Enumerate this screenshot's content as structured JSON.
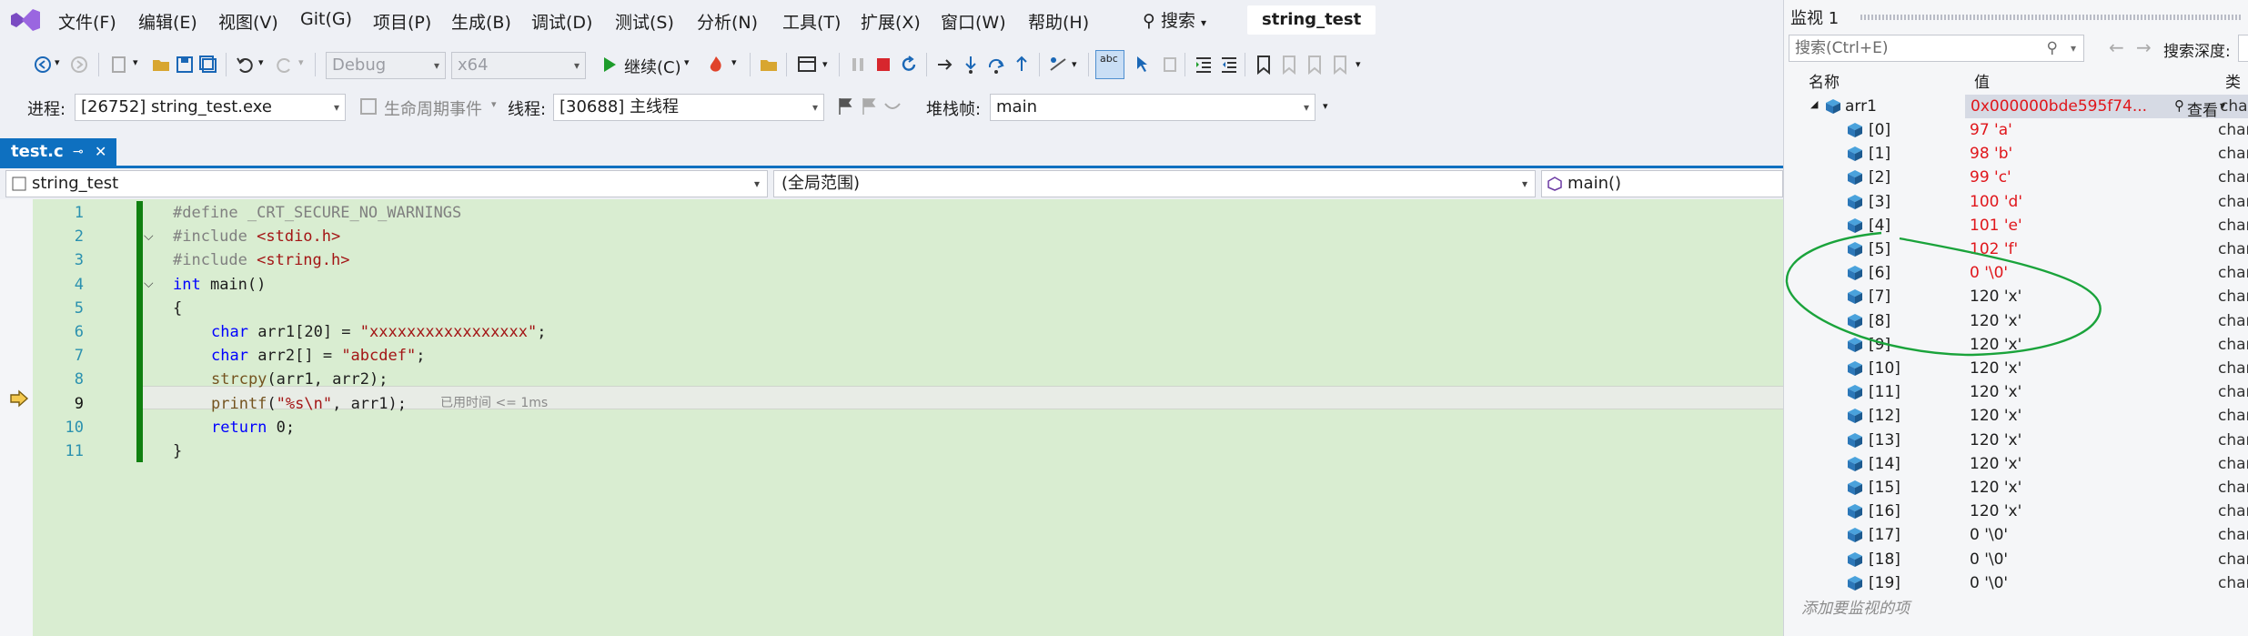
{
  "menu": {
    "items": [
      "文件(F)",
      "编辑(E)",
      "视图(V)",
      "Git(G)",
      "项目(P)",
      "生成(B)",
      "调试(D)",
      "测试(S)",
      "分析(N)",
      "工具(T)",
      "扩展(X)",
      "窗口(W)",
      "帮助(H)"
    ],
    "search_label": "搜索",
    "solution_title": "string_test"
  },
  "toolbar": {
    "config": "Debug",
    "platform": "x64",
    "continue_label": "继续(C)"
  },
  "debugbar": {
    "process_label": "进程:",
    "process_value": "[26752] string_test.exe",
    "lifecycle_label": "生命周期事件",
    "thread_label": "线程:",
    "thread_value": "[30688] 主线程",
    "stackframe_label": "堆栈帧:",
    "stackframe_value": "main"
  },
  "tab": {
    "name": "test.c",
    "pin": "⊸"
  },
  "navbar": {
    "project": "string_test",
    "scope": "(全局范围)",
    "member": "main()"
  },
  "editor": {
    "line_numbers": [
      "1",
      "2",
      "3",
      "4",
      "5",
      "6",
      "7",
      "8",
      "9",
      "10",
      "11"
    ],
    "current_line": 9,
    "perf_tip": "已用时间 <= 1ms",
    "lines": [
      {
        "text": "#define _CRT_SECURE_NO_WARNINGS"
      },
      {
        "text": "#include <stdio.h>"
      },
      {
        "text": "#include <string.h>"
      },
      {
        "text": "int main()"
      },
      {
        "text": "{"
      },
      {
        "text": "char arr1[20] = \"xxxxxxxxxxxxxxxxx\";"
      },
      {
        "text": "char arr2[] = \"abcdef\";"
      },
      {
        "text": "strcpy(arr1, arr2);"
      },
      {
        "text": "printf(\"%s\\n\", arr1);"
      },
      {
        "text": "return 0;"
      },
      {
        "text": "}"
      }
    ]
  },
  "watch": {
    "title": "监视 1",
    "search_placeholder": "搜索(Ctrl+E)",
    "search_depth_label": "搜索深度:",
    "col_name": "名称",
    "col_value": "值",
    "col_type": "类型",
    "root": {
      "name": "arr1",
      "value": "0x000000bde595f74...",
      "view": "查看",
      "type": "char"
    },
    "items": [
      {
        "name": "[0]",
        "value": "97 'a'",
        "changed": true,
        "type": "char"
      },
      {
        "name": "[1]",
        "value": "98 'b'",
        "changed": true,
        "type": "char"
      },
      {
        "name": "[2]",
        "value": "99 'c'",
        "changed": true,
        "type": "char"
      },
      {
        "name": "[3]",
        "value": "100 'd'",
        "changed": true,
        "type": "char"
      },
      {
        "name": "[4]",
        "value": "101 'e'",
        "changed": true,
        "type": "char"
      },
      {
        "name": "[5]",
        "value": "102 'f'",
        "changed": true,
        "type": "char"
      },
      {
        "name": "[6]",
        "value": "0 '\\0'",
        "changed": true,
        "type": "char"
      },
      {
        "name": "[7]",
        "value": "120 'x'",
        "changed": false,
        "type": "char"
      },
      {
        "name": "[8]",
        "value": "120 'x'",
        "changed": false,
        "type": "char"
      },
      {
        "name": "[9]",
        "value": "120 'x'",
        "changed": false,
        "type": "char"
      },
      {
        "name": "[10]",
        "value": "120 'x'",
        "changed": false,
        "type": "char"
      },
      {
        "name": "[11]",
        "value": "120 'x'",
        "changed": false,
        "type": "char"
      },
      {
        "name": "[12]",
        "value": "120 'x'",
        "changed": false,
        "type": "char"
      },
      {
        "name": "[13]",
        "value": "120 'x'",
        "changed": false,
        "type": "char"
      },
      {
        "name": "[14]",
        "value": "120 'x'",
        "changed": false,
        "type": "char"
      },
      {
        "name": "[15]",
        "value": "120 'x'",
        "changed": false,
        "type": "char"
      },
      {
        "name": "[16]",
        "value": "120 'x'",
        "changed": false,
        "type": "char"
      },
      {
        "name": "[17]",
        "value": "0 '\\0'",
        "changed": false,
        "type": "char"
      },
      {
        "name": "[18]",
        "value": "0 '\\0'",
        "changed": false,
        "type": "char"
      },
      {
        "name": "[19]",
        "value": "0 '\\0'",
        "changed": false,
        "type": "char"
      }
    ],
    "add_hint": "添加要监视的项"
  },
  "colors": {
    "accent": "#0e70c0",
    "code_bg": "#d9edd1",
    "changed_value": "#e0161b",
    "annotation_circle": "#1aa33b"
  }
}
